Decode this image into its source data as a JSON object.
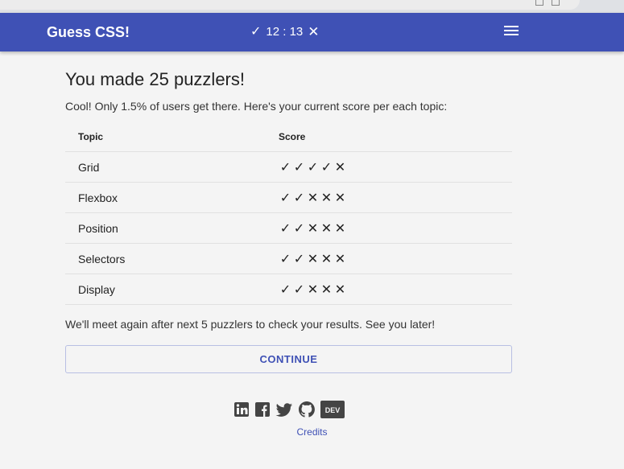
{
  "app": {
    "title": "Guess CSS!"
  },
  "timer": {
    "correct_icon": "check-icon",
    "value": "12 : 13",
    "wrong_icon": "close-icon"
  },
  "menu": {
    "icon": "menu-icon"
  },
  "result": {
    "heading": "You made 25 puzzlers!",
    "subtitle": "Cool! Only 1.5% of users get there. Here's your current score per each topic:",
    "columns": [
      "Topic",
      "Score"
    ],
    "rows": [
      {
        "topic": "Grid",
        "score": [
          "✓",
          "✓",
          "✓",
          "✓",
          "✕"
        ]
      },
      {
        "topic": "Flexbox",
        "score": [
          "✓",
          "✓",
          "✕",
          "✕",
          "✕"
        ]
      },
      {
        "topic": "Position",
        "score": [
          "✓",
          "✓",
          "✕",
          "✕",
          "✕"
        ]
      },
      {
        "topic": "Selectors",
        "score": [
          "✓",
          "✓",
          "✕",
          "✕",
          "✕"
        ]
      },
      {
        "topic": "Display",
        "score": [
          "✓",
          "✓",
          "✕",
          "✕",
          "✕"
        ]
      }
    ],
    "note": "We'll meet again after next 5 puzzlers to check your results. See you later!",
    "continue_label": "CONTINUE"
  },
  "social": {
    "icons": [
      "linkedin-icon",
      "facebook-icon",
      "twitter-icon",
      "github-icon",
      "dev-icon"
    ],
    "dev_label": "DEV"
  },
  "footer": {
    "credits_label": "Credits"
  }
}
